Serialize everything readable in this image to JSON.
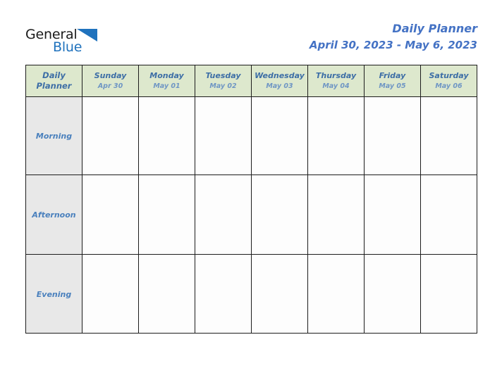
{
  "brand": {
    "name_part1": "General",
    "name_part2": "Blue",
    "triangle_icon": "triangle-logo-icon"
  },
  "header": {
    "title": "Daily Planner",
    "date_range": "April 30, 2023 - May 6, 2023"
  },
  "table": {
    "corner": {
      "line1": "Daily",
      "line2": "Planner"
    },
    "columns": [
      {
        "day": "Sunday",
        "date": "Apr 30"
      },
      {
        "day": "Monday",
        "date": "May 01"
      },
      {
        "day": "Tuesday",
        "date": "May 02"
      },
      {
        "day": "Wednesday",
        "date": "May 03"
      },
      {
        "day": "Thursday",
        "date": "May 04"
      },
      {
        "day": "Friday",
        "date": "May 05"
      },
      {
        "day": "Saturday",
        "date": "May 06"
      }
    ],
    "rows": [
      {
        "label": "Morning",
        "cells": [
          "",
          "",
          "",
          "",
          "",
          "",
          ""
        ]
      },
      {
        "label": "Afternoon",
        "cells": [
          "",
          "",
          "",
          "",
          "",
          "",
          ""
        ]
      },
      {
        "label": "Evening",
        "cells": [
          "",
          "",
          "",
          "",
          "",
          "",
          ""
        ]
      }
    ]
  },
  "colors": {
    "accent_blue": "#4472c4",
    "header_green": "#dde8cd",
    "row_label_gray": "#e8e8e8",
    "day_text": "#3d6ea6",
    "date_text": "#6f96c4",
    "logo_blue": "#1f72bd",
    "border": "#1c1c1c"
  }
}
